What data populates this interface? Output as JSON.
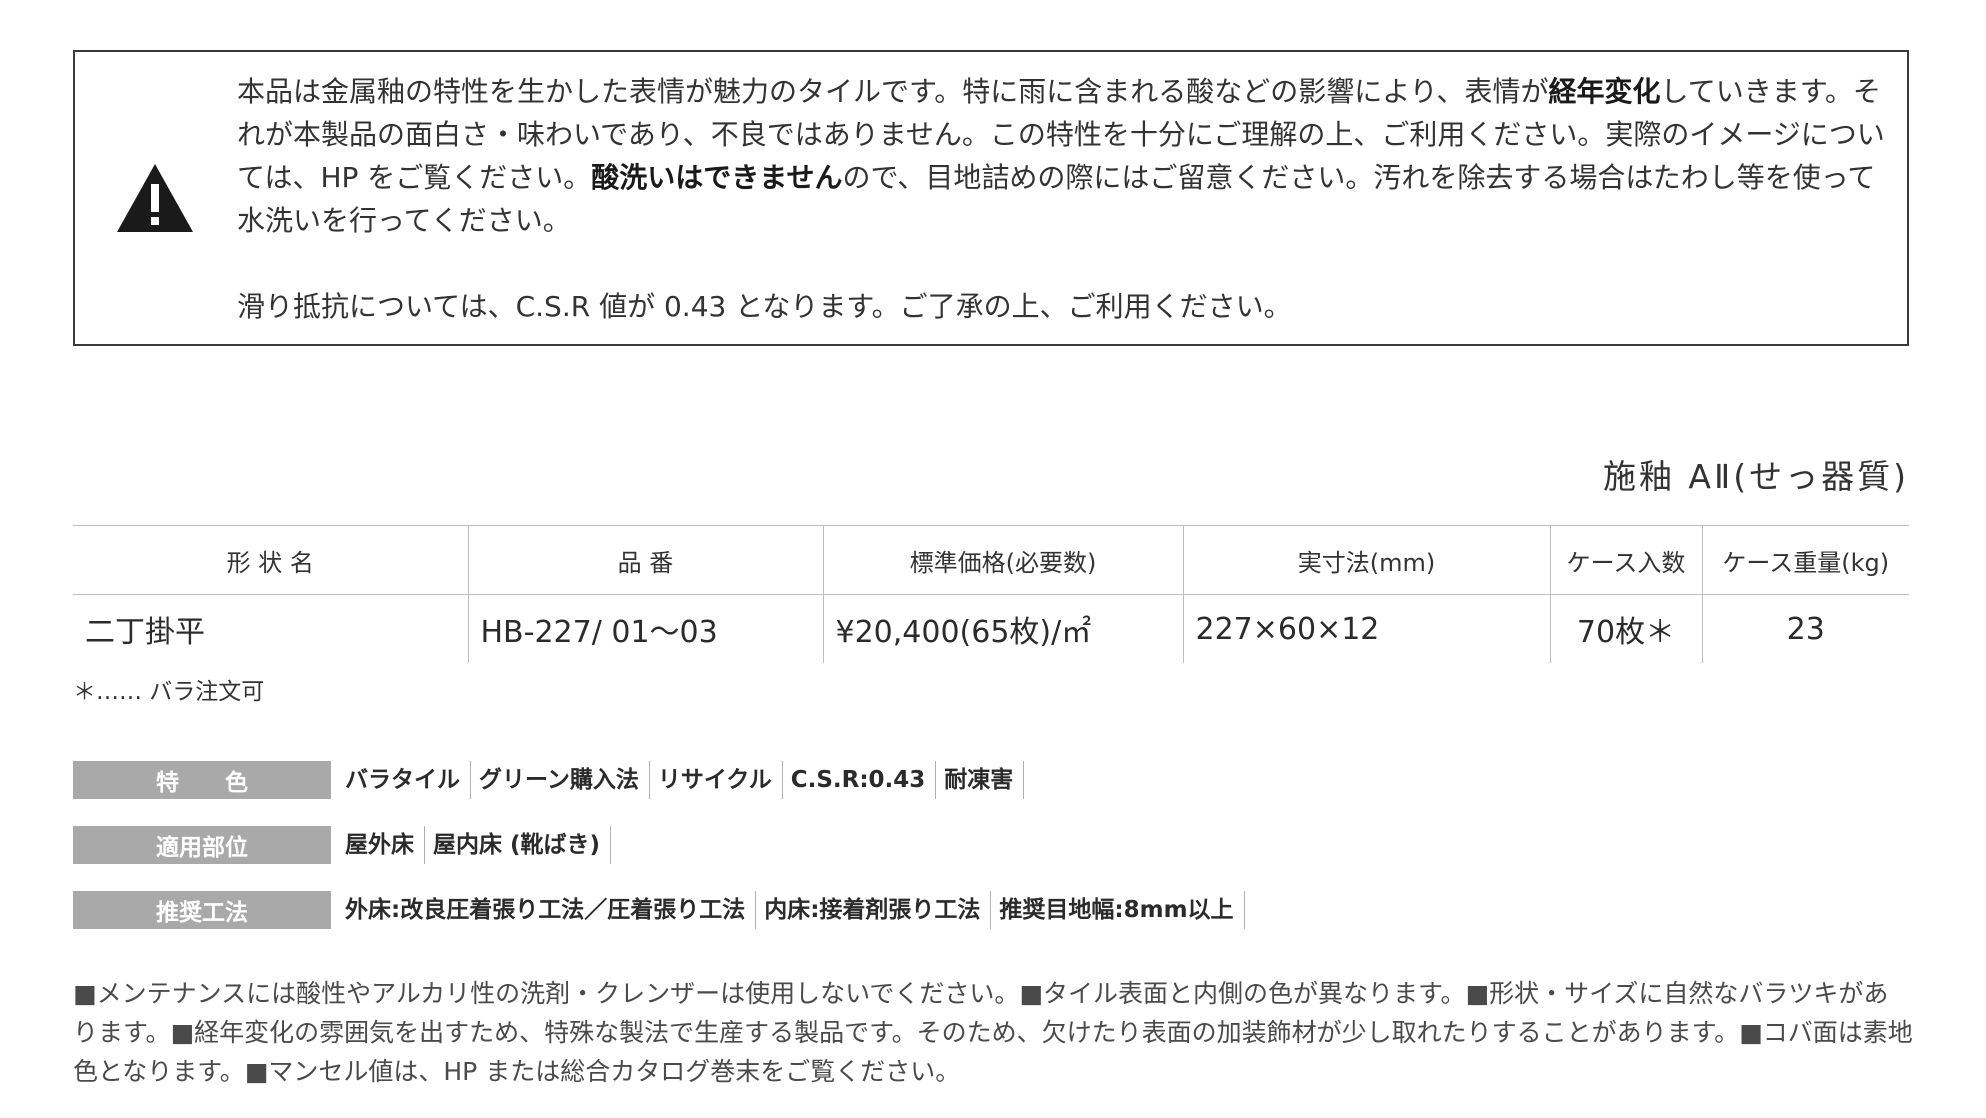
{
  "notice": {
    "p1_a": "本品は金属釉の特性を生かした表情が魅力のタイルです。特に雨に含まれる酸などの影響により、表情が",
    "p1_b": "経年変化",
    "p1_c": "していきます。それが本製品の面白さ・味わいであり、不良ではありません。この特性を十分にご理解の上、ご利用ください。実際のイメージについては、HP をご覧ください。",
    "p1_d": "酸洗いはできません",
    "p1_e": "ので、目地詰めの際にはご留意ください。汚れを除去する場合はたわし等を使って水洗いを行ってください。",
    "p2": "滑り抵抗については、C.S.R 値が 0.43 となります。ご了承の上、ご利用ください。"
  },
  "grade": "施釉 AⅡ(せっ器質)",
  "table": {
    "headers": [
      "形 状 名",
      "品 番",
      "標準価格(必要数)",
      "実寸法(mm)",
      "ケース入数",
      "ケース重量(kg)"
    ],
    "row": {
      "shape": "二丁掛平",
      "code": "HB-227/ 01〜03",
      "price": "¥20,400(65枚)/㎡",
      "size": "227×60×12",
      "per_case": "70枚＊",
      "weight": "23"
    }
  },
  "footnote": "＊…… バラ注文可",
  "attributes": [
    {
      "label": "特　　色",
      "items": [
        "バラタイル",
        "グリーン購入法",
        "リサイクル",
        "C.S.R:0.43",
        "耐凍害"
      ]
    },
    {
      "label": "適用部位",
      "items": [
        "屋外床",
        "屋内床 (靴ばき)"
      ]
    },
    {
      "label": "推奨工法",
      "items": [
        "外床:改良圧着張り工法／圧着張り工法",
        "内床:接着剤張り工法",
        "推奨目地幅:8mm以上"
      ]
    }
  ],
  "notes": "■メンテナンスには酸性やアルカリ性の洗剤・クレンザーは使用しないでください。■タイル表面と内側の色が異なります。■形状・サイズに自然なバラツキがあります。■経年変化の雰囲気を出すため、特殊な製法で生産する製品です。そのため、欠けたり表面の加装飾材が少し取れたりすることがあります。■コバ面は素地色となります。■マンセル値は、HP または総合カタログ巻末をご覧ください。"
}
